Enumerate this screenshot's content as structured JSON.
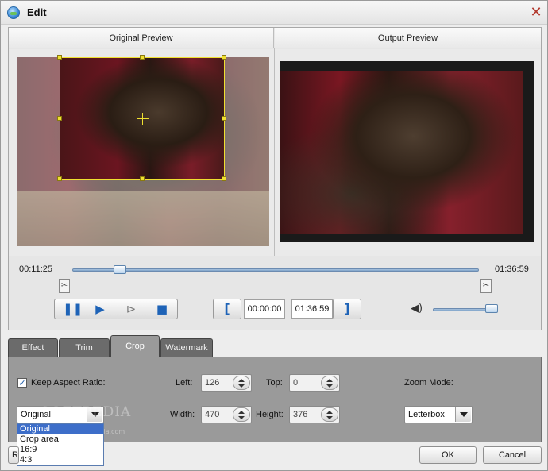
{
  "window": {
    "title": "Edit"
  },
  "preview": {
    "original_label": "Original Preview",
    "output_label": "Output Preview"
  },
  "timeline": {
    "current_time": "00:11:25",
    "total_time": "01:36:59",
    "position_fraction": 0.1177
  },
  "playback": {
    "mark_in_time": "00:00:00",
    "mark_out_time": "01:36:59",
    "volume_fraction": 0.95
  },
  "tabs": [
    {
      "label": "Effect"
    },
    {
      "label": "Trim"
    },
    {
      "label": "Crop",
      "active": true
    },
    {
      "label": "Watermark"
    }
  ],
  "crop": {
    "keep_aspect_label": "Keep Aspect Ratio:",
    "keep_aspect_checked": true,
    "left_label": "Left:",
    "left_value": "126",
    "top_label": "Top:",
    "top_value": "0",
    "width_label": "Width:",
    "width_value": "470",
    "height_label": "Height:",
    "height_value": "376",
    "zoom_mode_label": "Zoom Mode:",
    "zoom_mode_value": "Letterbox",
    "aspect_select_value": "Original",
    "aspect_options": [
      "Original",
      "Crop area",
      "16:9",
      "4:3"
    ]
  },
  "footer": {
    "reset_label": "R",
    "ok_label": "OK",
    "cancel_label": "Cancel"
  },
  "watermark_text": "SOFTPEDIA",
  "watermark_url": "www.softpedia.com",
  "icons": {
    "app": "app-globe-icon",
    "close": "close-icon",
    "scissors": "scissors-icon",
    "pause": "pause-icon",
    "play": "play-icon",
    "next_frame": "next-frame-icon",
    "stop": "stop-icon",
    "speaker": "speaker-icon"
  },
  "colors": {
    "accent": "#1e63b7",
    "crop_border": "#f0e030",
    "panel_bg": "#9a9a9a",
    "close": "#b33a2e"
  }
}
